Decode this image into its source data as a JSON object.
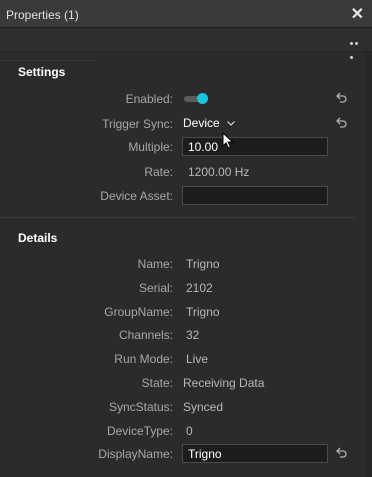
{
  "window": {
    "title": "Properties (1)"
  },
  "settings": {
    "header": "Settings",
    "enabled_label": "Enabled:",
    "enabled_on": true,
    "trigger_label": "Trigger Sync:",
    "trigger_value": "Device",
    "multiple_label": "Multiple:",
    "multiple_value": "10.00",
    "rate_label": "Rate:",
    "rate_value": "1200.00 Hz",
    "asset_label": "Device Asset:",
    "asset_value": ""
  },
  "details": {
    "header": "Details",
    "rows": [
      {
        "label": "Name:",
        "value": "Trigno"
      },
      {
        "label": "Serial:",
        "value": "2102"
      },
      {
        "label": "GroupName:",
        "value": "Trigno"
      },
      {
        "label": "Channels:",
        "value": "32"
      },
      {
        "label": "Run Mode:",
        "value": "Live"
      },
      {
        "label": "State:",
        "value": "Receiving Data"
      },
      {
        "label": "SyncStatus:",
        "value": "Synced"
      },
      {
        "label": "DeviceType:",
        "value": "0"
      },
      {
        "label": "DisplayName:",
        "value": "Trigno"
      }
    ]
  },
  "colors": {
    "accent": "#19c4de",
    "background": "#2b2b2b",
    "field": "#1c1c1c"
  },
  "icons": {
    "close": "close-icon",
    "more": "more-options-icon",
    "reset": "reset-arrow-icon"
  }
}
